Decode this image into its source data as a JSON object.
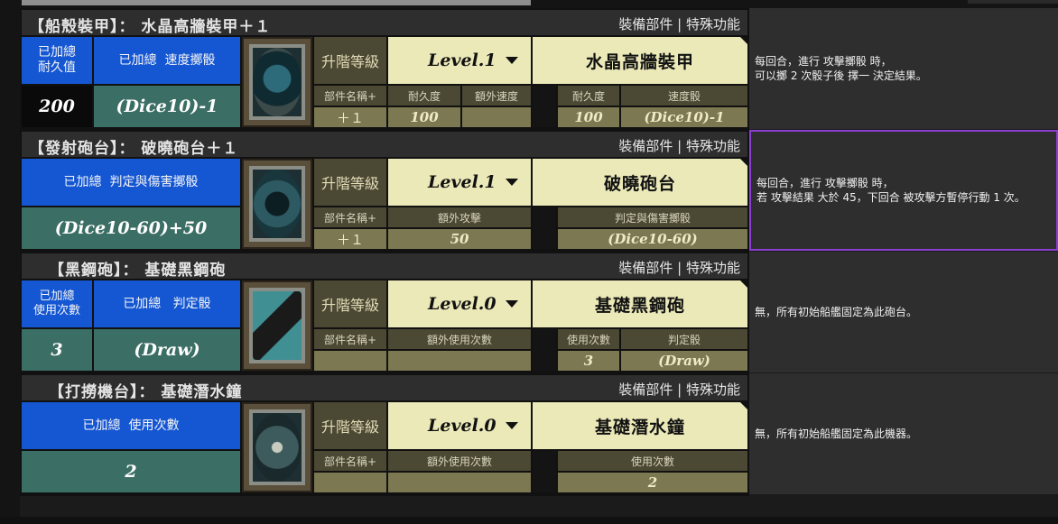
{
  "panels": [
    {
      "title": "【船殼裝甲】： 水晶高牆裝甲＋１",
      "header_right": "裝備部件 | 特殊功能",
      "stat_labels": [
        "已加總\n耐久值",
        "已加總  速度擲骰"
      ],
      "stat_values": [
        "200",
        "(Dice10)-1"
      ],
      "upgrade_label": "升階等級",
      "level": "Level.1",
      "part_name": "水晶高牆裝甲",
      "part_name_label": "部件名稱+",
      "part_plus": "＋１",
      "extra_labels": [
        "耐久度",
        "額外速度"
      ],
      "extra_values": [
        "100",
        ""
      ],
      "base_labels": [
        "耐久度",
        "速度骰"
      ],
      "base_values": [
        "100",
        "(Dice10)-1"
      ],
      "description": "每回合，進行 攻擊擲骰 時，\n可以擲 2 次骰子後 擇一 決定結果。",
      "icon": "armor-icon"
    },
    {
      "title": "【發射砲台】： 破曉砲台＋１",
      "header_right": "裝備部件 | 特殊功能",
      "stat_labels": [
        "已加總  判定與傷害擲骰"
      ],
      "stat_values": [
        "(Dice10-60)+50"
      ],
      "upgrade_label": "升階等級",
      "level": "Level.1",
      "part_name": "破曉砲台",
      "part_name_label": "部件名稱+",
      "part_plus": "＋１",
      "extra_labels": [
        "額外攻擊"
      ],
      "extra_values": [
        "50"
      ],
      "base_labels": [
        "判定與傷害擲骰"
      ],
      "base_values": [
        "(Dice10-60)"
      ],
      "description": "每回合，進行 攻擊擲骰 時，\n若 攻擊結果 大於 45，下回合 被攻擊方暫停行動 1 次。",
      "icon": "cannon-turret-icon"
    },
    {
      "title": "【黑鋼砲】： 基礎黑鋼砲",
      "header_right": "裝備部件 | 特殊功能",
      "stat_labels": [
        "已加總\n使用次數",
        "已加總   判定骰"
      ],
      "stat_values": [
        "3",
        "(Draw)"
      ],
      "upgrade_label": "升階等級",
      "level": "Level.0",
      "part_name": "基礎黑鋼砲",
      "part_name_label": "部件名稱+",
      "part_plus": "",
      "extra_labels": [
        "額外使用次數"
      ],
      "extra_values": [
        ""
      ],
      "base_labels": [
        "使用次數",
        "判定骰"
      ],
      "base_values": [
        "3",
        "(Draw)"
      ],
      "description": "無，所有初始船艦固定為此砲台。",
      "icon": "black-steel-cannon-icon"
    },
    {
      "title": "【打撈機台】： 基礎潛水鐘",
      "header_right": "裝備部件 | 特殊功能",
      "stat_labels": [
        "已加總  使用次數"
      ],
      "stat_values": [
        "2"
      ],
      "upgrade_label": "升階等級",
      "level": "Level.0",
      "part_name": "基礎潛水鐘",
      "part_name_label": "部件名稱+",
      "part_plus": "",
      "extra_labels": [
        "額外使用次數"
      ],
      "extra_values": [
        ""
      ],
      "base_labels": [
        "使用次數"
      ],
      "base_values": [
        "2"
      ],
      "description": "無，所有初始船艦固定為此機器。",
      "icon": "diving-bell-icon"
    }
  ],
  "colors": {
    "accent_blue": "#1557d3",
    "teal": "#3b6e64",
    "cream": "#ebe9b8",
    "olive": "#7c7852",
    "selected_border": "#8b3fd1"
  }
}
